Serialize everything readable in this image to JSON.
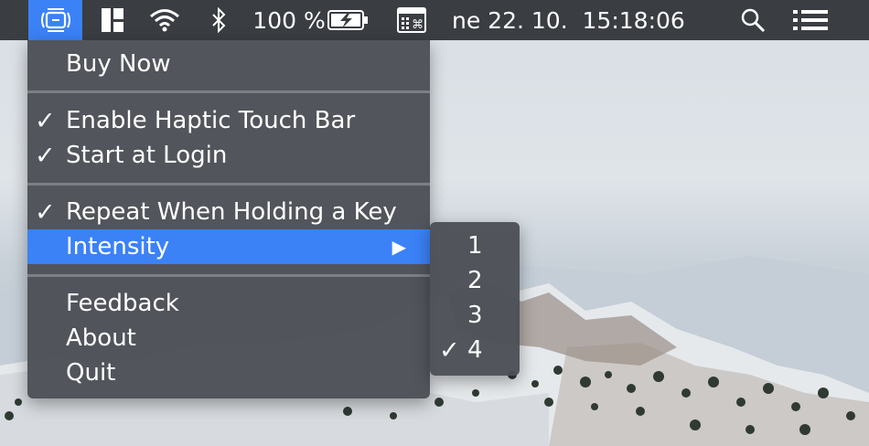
{
  "menubar": {
    "battery_percent": "100 %",
    "datetime": "ne 22. 10.  15:18:06",
    "icons": [
      "haptic-app-icon",
      "layout-icon",
      "wifi-icon",
      "bluetooth-icon",
      "battery-charging-icon",
      "keyboard-input-icon",
      "search-icon",
      "list-icon"
    ]
  },
  "menu": {
    "buy_now": "Buy Now",
    "enable_haptic": "Enable Haptic Touch Bar",
    "start_login": "Start at Login",
    "repeat_key": "Repeat When Holding a Key",
    "intensity": "Intensity",
    "feedback": "Feedback",
    "about": "About",
    "quit": "Quit",
    "check_glyph": "✓",
    "submenu_arrow": "▶"
  },
  "submenu": {
    "items": [
      "1",
      "2",
      "3",
      "4"
    ],
    "selected": "4"
  },
  "colors": {
    "highlight": "#3b82f6",
    "menubar": "#3a3d42",
    "menu_bg": "#4c4f55"
  }
}
